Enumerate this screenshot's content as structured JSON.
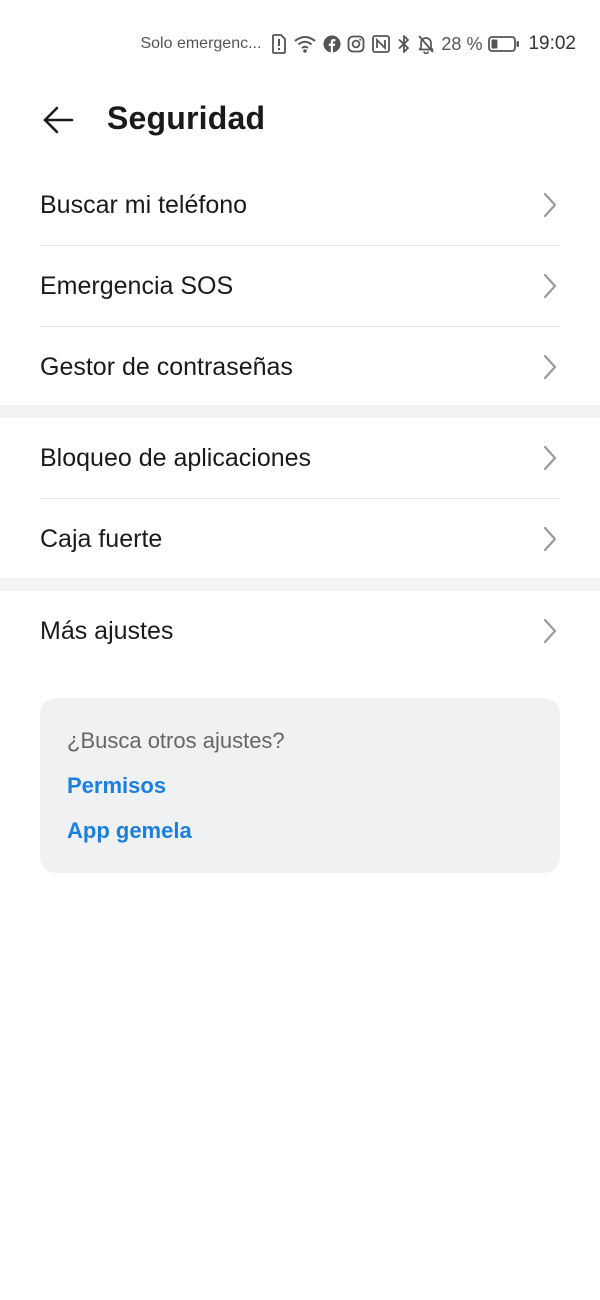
{
  "status_bar": {
    "carrier_text": "Solo emergenc...",
    "battery_percent": "28 %",
    "battery_level": 0.28,
    "time": "19:02",
    "icons": [
      "sim-alert-icon",
      "wifi-icon",
      "facebook-icon",
      "instagram-icon",
      "nfc-icon",
      "bluetooth-icon",
      "bell-off-icon",
      "battery-icon"
    ]
  },
  "header": {
    "title": "Seguridad"
  },
  "groups": [
    {
      "items": [
        {
          "label": "Buscar mi teléfono"
        },
        {
          "label": "Emergencia SOS"
        },
        {
          "label": "Gestor de contraseñas"
        }
      ]
    },
    {
      "items": [
        {
          "label": "Bloqueo de aplicaciones"
        },
        {
          "label": "Caja fuerte"
        }
      ]
    },
    {
      "items": [
        {
          "label": "Más ajustes"
        }
      ]
    }
  ],
  "suggestions": {
    "title": "¿Busca otros ajustes?",
    "links": [
      {
        "label": "Permisos"
      },
      {
        "label": "App gemela"
      }
    ]
  },
  "colors": {
    "link": "#1a7fe0",
    "separator_band": "#f2f3f5",
    "card_background": "#f0f1f3"
  }
}
